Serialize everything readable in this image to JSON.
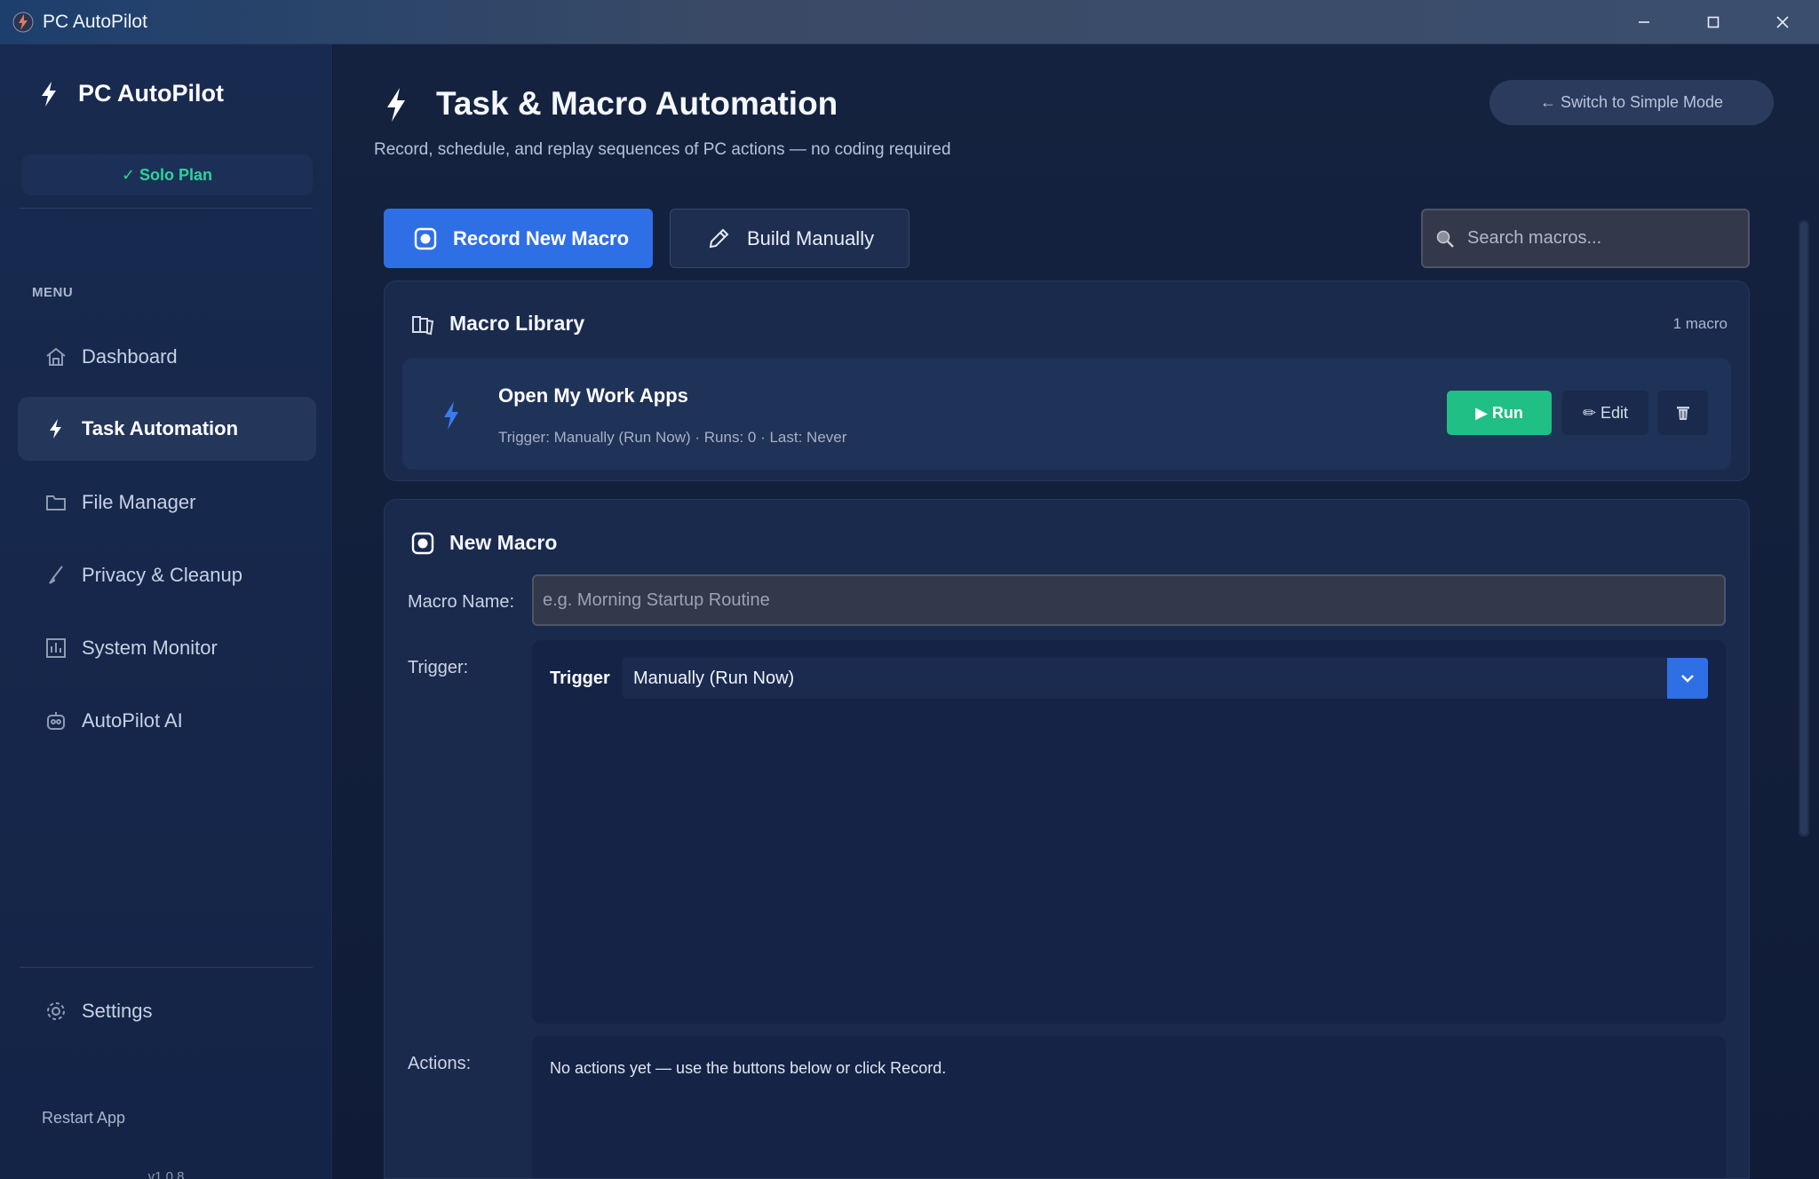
{
  "window": {
    "title": "PC AutoPilot"
  },
  "sidebar": {
    "brand": "PC AutoPilot",
    "plan_badge": "✓ Solo Plan",
    "menu_heading": "MENU",
    "items": [
      {
        "label": "Dashboard",
        "icon": "home-icon",
        "active": false
      },
      {
        "label": "Task Automation",
        "icon": "bolt-icon",
        "active": true
      },
      {
        "label": "File Manager",
        "icon": "folder-icon",
        "active": false
      },
      {
        "label": "Privacy & Cleanup",
        "icon": "brush-icon",
        "active": false
      },
      {
        "label": "System Monitor",
        "icon": "chart-icon",
        "active": false
      },
      {
        "label": "AutoPilot AI",
        "icon": "robot-icon",
        "active": false
      }
    ],
    "settings_label": "Settings",
    "restart_label": "Restart App",
    "version": "v1.0.8"
  },
  "header": {
    "title": "Task & Macro Automation",
    "subtitle": "Record, schedule, and replay sequences of PC actions — no coding required",
    "simple_mode_label": "← Switch to Simple Mode"
  },
  "toolbar": {
    "record_label": "Record New Macro",
    "build_label": "Build Manually",
    "search_placeholder": "Search macros..."
  },
  "library": {
    "title": "Macro Library",
    "count": "1 macro",
    "macros": [
      {
        "name": "Open My Work Apps",
        "meta": "Trigger: Manually (Run Now)  ·  Runs: 0  ·  Last: Never",
        "run_label": "▶ Run",
        "edit_label": "✏ Edit"
      }
    ]
  },
  "new_macro": {
    "title": "New Macro",
    "name_label": "Macro Name:",
    "name_placeholder": "e.g. Morning Startup Routine",
    "name_value": "",
    "trigger_label": "Trigger:",
    "trigger_inner_label": "Trigger",
    "trigger_selected": "Manually (Run Now)",
    "actions_label": "Actions:",
    "actions_empty": "No actions yet — use the buttons below or click Record."
  },
  "colors": {
    "accent": "#2f6fe6",
    "success": "#1fbf85",
    "plan_green": "#2ed39a",
    "background": "#101c37"
  }
}
